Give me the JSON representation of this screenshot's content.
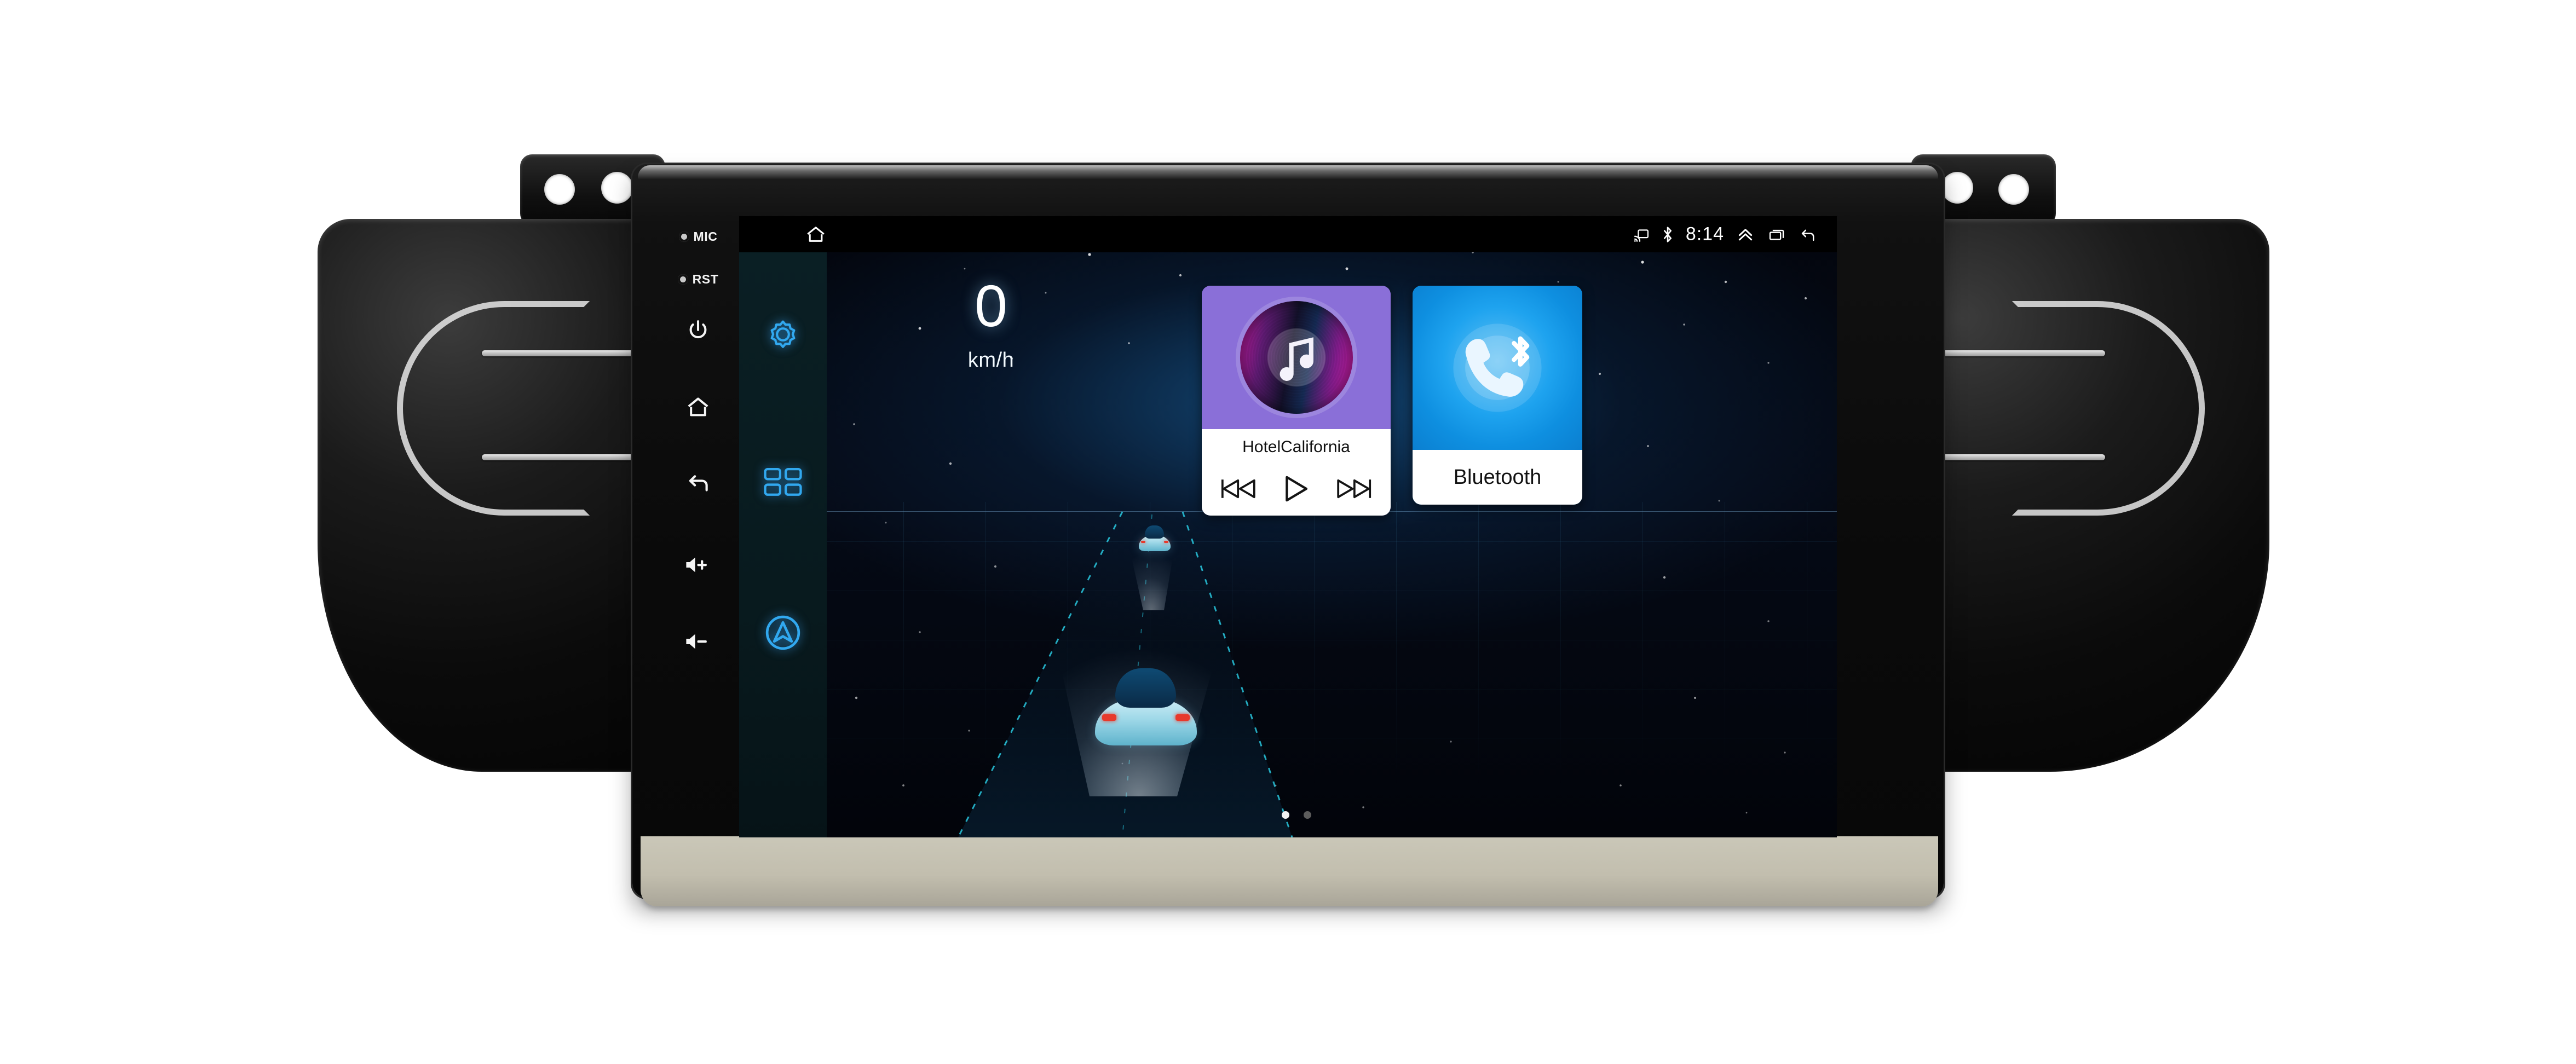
{
  "device": {
    "hardware_keys": [
      {
        "icon": "mic-indicator-icon",
        "label": "MIC"
      },
      {
        "icon": "reset-indicator-icon",
        "label": "RST"
      },
      {
        "icon": "power-icon",
        "label": ""
      },
      {
        "icon": "home-icon",
        "label": ""
      },
      {
        "icon": "back-icon",
        "label": ""
      },
      {
        "icon": "volume-up-icon",
        "label": ""
      },
      {
        "icon": "volume-down-icon",
        "label": ""
      }
    ]
  },
  "statusbar": {
    "home_icon": "home-icon",
    "clock": "8:14",
    "icons": [
      {
        "name": "cast-icon"
      },
      {
        "name": "bluetooth-icon"
      },
      {
        "name": "chevron-up-icon"
      },
      {
        "name": "recent-apps-icon"
      },
      {
        "name": "back-icon"
      }
    ]
  },
  "sidebar": {
    "items": [
      {
        "icon": "gear-icon",
        "label": "Settings"
      },
      {
        "icon": "apps-grid-icon",
        "label": "Apps"
      },
      {
        "icon": "navigation-icon",
        "label": "Navigation"
      }
    ]
  },
  "speed_widget": {
    "value": "0",
    "unit": "km/h"
  },
  "music_widget": {
    "title": "HotelCalifornia",
    "art_icon": "music-note-icon",
    "controls": [
      {
        "name": "previous-track-button",
        "icon": "previous-icon"
      },
      {
        "name": "play-button",
        "icon": "play-icon"
      },
      {
        "name": "next-track-button",
        "icon": "next-icon"
      }
    ]
  },
  "bluetooth_widget": {
    "label": "Bluetooth",
    "art_icon": "phone-bluetooth-icon"
  },
  "pager": {
    "pages": 2,
    "active_index": 0
  },
  "colors": {
    "accent_blue": "#2FA8F0",
    "music_purple": "#8A6FD8",
    "bluetooth_blue": "#15A0EE",
    "sidebar_bg": "#0A1F24",
    "screen_bg": "#03060E",
    "status_text": "#FFFFFF"
  }
}
